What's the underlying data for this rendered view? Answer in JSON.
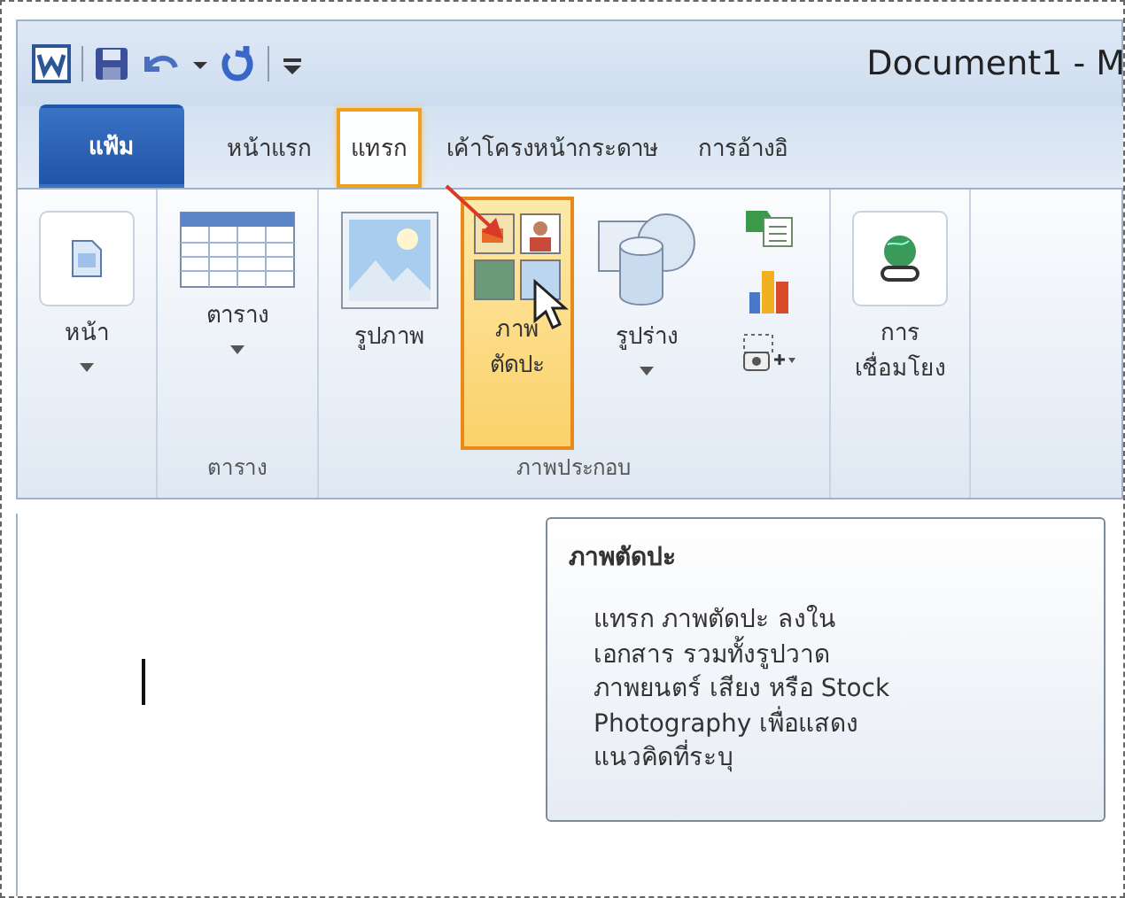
{
  "window": {
    "title": "Document1 - M"
  },
  "tabs": [
    {
      "label": "แฟ้ม",
      "kind": "file",
      "selected": false,
      "highlighted": false
    },
    {
      "label": "หน้าแรก",
      "kind": "tab",
      "selected": false,
      "highlighted": false
    },
    {
      "label": "แทรก",
      "kind": "tab",
      "selected": true,
      "highlighted": true
    },
    {
      "label": "เค้าโครงหน้ากระดาษ",
      "kind": "tab",
      "selected": false,
      "highlighted": false
    },
    {
      "label": "การอ้างอิ",
      "kind": "tab",
      "selected": false,
      "highlighted": false
    }
  ],
  "ribbon_groups": [
    {
      "buttons": [
        {
          "label": "หน้า",
          "kind": "page",
          "dropdown": true,
          "highlighted": false
        }
      ]
    },
    {
      "label": "ตาราง",
      "buttons": [
        {
          "label": "ตาราง",
          "kind": "table",
          "dropdown": true,
          "highlighted": false
        }
      ]
    },
    {
      "label": "ภาพประกอบ",
      "buttons": [
        {
          "label": "รูปภาพ",
          "kind": "picture",
          "dropdown": false,
          "highlighted": false
        },
        {
          "label": "ภาพ\nตัดปะ",
          "kind": "clipart",
          "dropdown": false,
          "highlighted": true
        },
        {
          "label": "รูปร่าง",
          "kind": "shapes",
          "dropdown": true,
          "highlighted": false
        },
        {
          "kind": "small"
        }
      ]
    },
    {
      "buttons": [
        {
          "label": "การ\nเชื่อมโยง",
          "kind": "link",
          "dropdown": false,
          "highlighted": false
        }
      ]
    }
  ],
  "tooltip": {
    "title": "ภาพตัดปะ",
    "body": "แทรก ภาพตัดปะ ลงใน\nเอกสาร รวมทั้งรูปวาด\nภาพยนตร์ เสียง หรือ Stock\nPhotography เพื่อแสดง\nแนวคิดที่ระบุ"
  }
}
